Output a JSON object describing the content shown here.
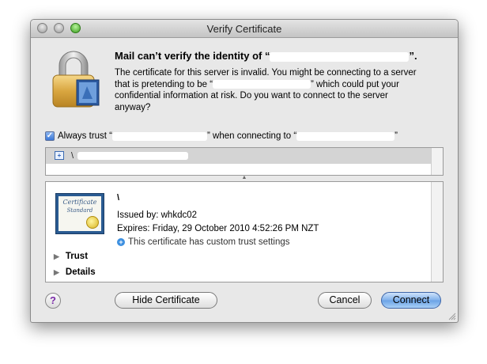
{
  "window": {
    "title": "Verify Certificate"
  },
  "message": {
    "headline": "Mail can’t verify the identity of “",
    "headline_end": "”.",
    "line1": "The certificate for this server is invalid. You might be connecting to a server",
    "line2_start": "that is pretending to be “",
    "line2_end": "” which could put your",
    "line3": "confidential information at risk. Do you want to connect to the server",
    "line4": "anyway?"
  },
  "trust_option": {
    "checked": true,
    "label_start": "Always trust “",
    "label_mid": "” when connecting to “",
    "label_end": "”"
  },
  "cert_list": {
    "row_label": "\\"
  },
  "cert_detail": {
    "badge_line1": "Certificate",
    "badge_line2": "Standard",
    "name": "\\",
    "issued_by": "Issued by: whkdc02",
    "expires": "Expires: Friday, 29 October 2010 4:52:26 PM NZT",
    "custom_trust": "This certificate has custom trust settings",
    "trust_label": "Trust",
    "details_label": "Details"
  },
  "buttons": {
    "help": "?",
    "hide_certificate": "Hide Certificate",
    "cancel": "Cancel",
    "connect": "Connect"
  },
  "colors": {
    "accent": "#6aa2e6",
    "help_glyph": "#7a2aa8"
  }
}
